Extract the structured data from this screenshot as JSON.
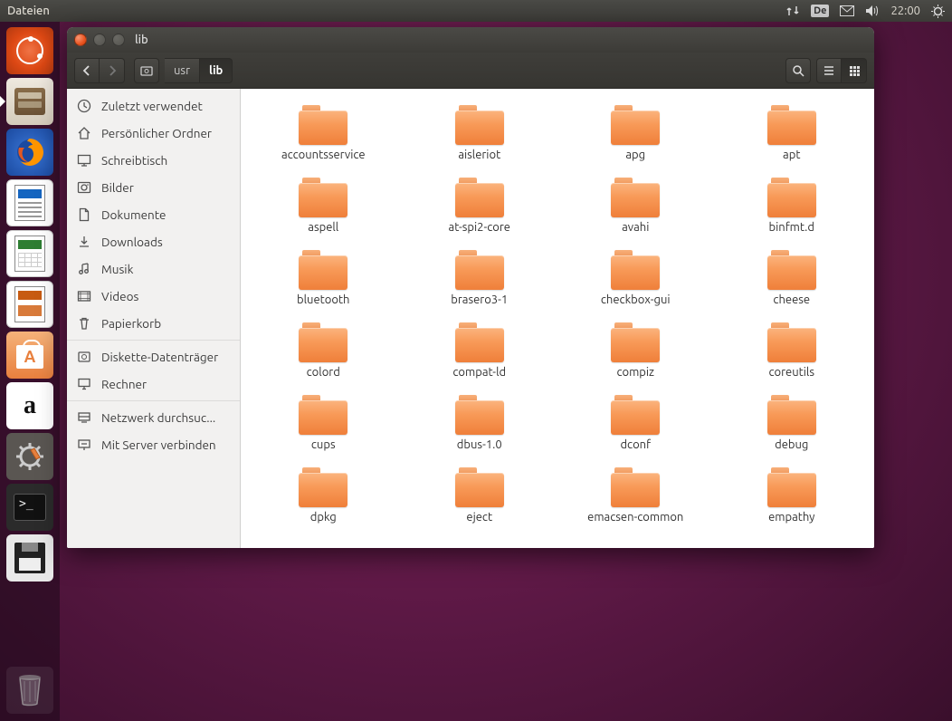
{
  "menubar": {
    "app_title": "Dateien",
    "keyboard_indicator": "De",
    "clock": "22:00"
  },
  "window": {
    "title": "lib",
    "path": [
      "usr",
      "lib"
    ],
    "active_path_index": 1
  },
  "sidebar": {
    "places": [
      {
        "icon": "recent",
        "label": "Zuletzt verwendet"
      },
      {
        "icon": "home",
        "label": "Persönlicher Ordner"
      },
      {
        "icon": "desktop",
        "label": "Schreibtisch"
      },
      {
        "icon": "pictures",
        "label": "Bilder"
      },
      {
        "icon": "documents",
        "label": "Dokumente"
      },
      {
        "icon": "downloads",
        "label": "Downloads"
      },
      {
        "icon": "music",
        "label": "Musik"
      },
      {
        "icon": "videos",
        "label": "Videos"
      },
      {
        "icon": "trash",
        "label": "Papierkorb"
      }
    ],
    "devices": [
      {
        "icon": "disk",
        "label": "Diskette-Datenträger"
      },
      {
        "icon": "computer",
        "label": "Rechner"
      }
    ],
    "network": [
      {
        "icon": "browse",
        "label": "Netzwerk durchsuc..."
      },
      {
        "icon": "connect",
        "label": "Mit Server verbinden"
      }
    ]
  },
  "folders": [
    "accountsservice",
    "aisleriot",
    "apg",
    "apt",
    "aspell",
    "at-spi2-core",
    "avahi",
    "binfmt.d",
    "bluetooth",
    "brasero3-1",
    "checkbox-gui",
    "cheese",
    "colord",
    "compat-ld",
    "compiz",
    "coreutils",
    "cups",
    "dbus-1.0",
    "dconf",
    "debug",
    "dpkg",
    "eject",
    "emacsen-common",
    "empathy"
  ],
  "launcher": [
    {
      "id": "dash",
      "name": "Dash"
    },
    {
      "id": "files",
      "name": "Dateien",
      "active": true
    },
    {
      "id": "firefox",
      "name": "Firefox"
    },
    {
      "id": "writer",
      "name": "LibreOffice Writer"
    },
    {
      "id": "calc",
      "name": "LibreOffice Calc"
    },
    {
      "id": "impress",
      "name": "LibreOffice Impress"
    },
    {
      "id": "software",
      "name": "Ubuntu Software"
    },
    {
      "id": "amazon",
      "name": "Amazon"
    },
    {
      "id": "settings",
      "name": "Systemeinstellungen"
    },
    {
      "id": "terminal",
      "name": "Terminal"
    },
    {
      "id": "floppy",
      "name": "Diskette"
    }
  ]
}
